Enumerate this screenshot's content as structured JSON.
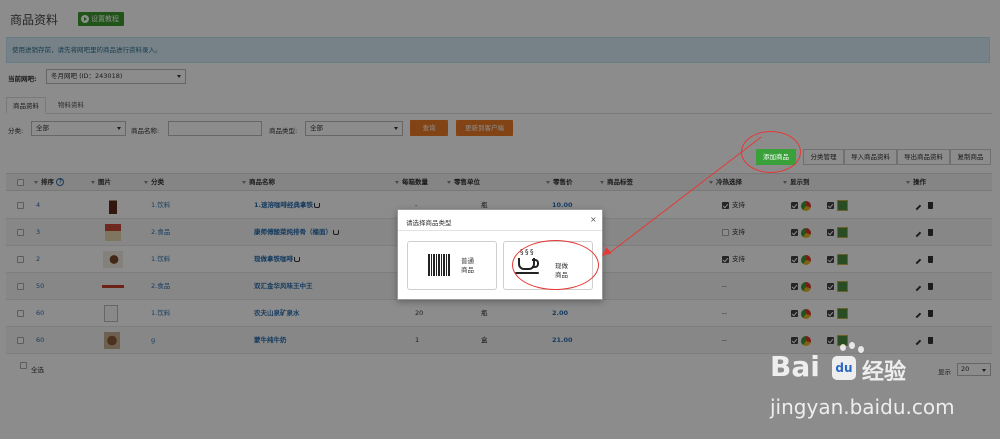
{
  "header": {
    "title": "商品资料",
    "help_label": "设置教程"
  },
  "notice": "使用进销存前，请先将网吧里的商品进行资料录入。",
  "shop": {
    "label": "当前网吧:",
    "value": "冬月网吧 (ID：243018)"
  },
  "tabs": [
    {
      "label": "商品资料",
      "active": true
    },
    {
      "label": "物料资料",
      "active": false
    }
  ],
  "filters": {
    "category_label": "分类:",
    "category_value": "全部",
    "name_label": "商品名称:",
    "name_value": "",
    "type_label": "商品类型:",
    "type_value": "全部",
    "query_button": "查询",
    "import_client_button": "更新到客户端"
  },
  "toolbar": {
    "add_button": "添加商品",
    "category_button": "分类管理",
    "import_button": "导入商品资料",
    "export_button": "导出商品资料",
    "copy_button": "复制商品"
  },
  "table": {
    "columns": [
      "排序",
      "图片",
      "分类",
      "商品名称",
      "每箱数量",
      "零售单位",
      "零售价",
      "商品标签",
      "冷热选择",
      "显示到",
      "操作"
    ],
    "rows": [
      {
        "sort": "4",
        "category": "1.饮料",
        "name": "1.速溶咖啡经典拿铁",
        "case_qty": "-",
        "unit": "瓶",
        "price": "10.00",
        "temp": "支持",
        "temp_checked": true,
        "thumb": "bottle"
      },
      {
        "sort": "3",
        "category": "2.食品",
        "name": "康师傅酸菜炖排骨（桶面）",
        "case_qty": "",
        "unit": "",
        "price": "",
        "temp": "支持",
        "temp_checked": false,
        "thumb": "cup"
      },
      {
        "sort": "2",
        "category": "1.饮料",
        "name": "现做拿铁咖啡",
        "case_qty": "",
        "unit": "",
        "price": "",
        "temp": "支持",
        "temp_checked": true,
        "thumb": "coffee"
      },
      {
        "sort": "50",
        "category": "2.食品",
        "name": "双汇金华风味王中王",
        "case_qty": "",
        "unit": "",
        "price": "",
        "temp": "--",
        "temp_checked": false,
        "thumb": "sausage"
      },
      {
        "sort": "60",
        "category": "1.饮料",
        "name": "农夫山泉矿泉水",
        "case_qty": "20",
        "unit": "瓶",
        "price": "2.00",
        "temp": "--",
        "temp_checked": false,
        "thumb": "broken"
      },
      {
        "sort": "60",
        "category": "g",
        "name": "蒙牛纯牛奶",
        "case_qty": "1",
        "unit": "盒",
        "price": "21.00",
        "temp": "--",
        "temp_checked": false,
        "thumb": "milk"
      }
    ]
  },
  "footer": {
    "select_all": "全选",
    "page_size_label": "显示",
    "page_size": "20"
  },
  "modal": {
    "title": "请选择商品类型",
    "close": "×",
    "options": [
      {
        "label_line1": "普通",
        "label_line2": "商品",
        "icon": "barcode-icon"
      },
      {
        "label_line1": "现做",
        "label_line2": "商品",
        "icon": "coffee-cup-icon"
      }
    ]
  },
  "watermark": {
    "bai": "Bai",
    "du": "du",
    "jingyan": "经验",
    "url": "jingyan.baidu.com"
  },
  "colors": {
    "green": "#3aa13a",
    "orange": "#ee7c27",
    "link": "#2a6db0",
    "annotation": "#e53935"
  }
}
